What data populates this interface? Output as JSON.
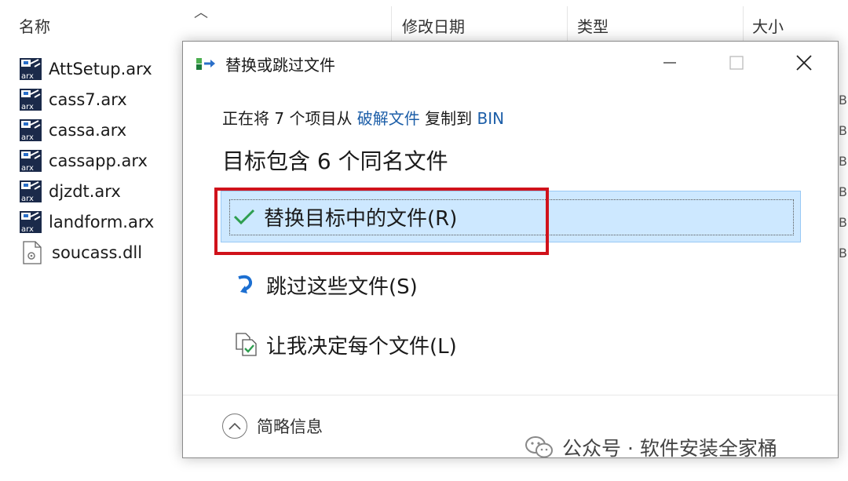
{
  "explorer": {
    "columns": {
      "name": "名称",
      "modified": "修改日期",
      "type": "类型",
      "size": "大小"
    },
    "files": [
      {
        "name": "AttSetup.arx",
        "icon": "arx-file-icon"
      },
      {
        "name": "cass7.arx",
        "icon": "arx-file-icon"
      },
      {
        "name": "cassa.arx",
        "icon": "arx-file-icon"
      },
      {
        "name": "cassapp.arx",
        "icon": "arx-file-icon"
      },
      {
        "name": "djzdt.arx",
        "icon": "arx-file-icon"
      },
      {
        "name": "landform.arx",
        "icon": "arx-file-icon"
      },
      {
        "name": "soucass.dll",
        "icon": "dll-file-icon"
      }
    ],
    "size_fragment": "B"
  },
  "dialog": {
    "title": "替换或跳过文件",
    "copy_line": {
      "prefix": "正在将 7 个项目从 ",
      "source": "破解文件",
      "middle": " 复制到 ",
      "target": "BIN"
    },
    "heading": "目标包含 6 个同名文件",
    "options": {
      "replace": "替换目标中的文件(R)",
      "skip": "跳过这些文件(S)",
      "decide": "让我决定每个文件(L)"
    },
    "footer": {
      "details": "简略信息"
    },
    "colors": {
      "highlight": "#cde8ff",
      "link": "#1c5ea8",
      "annotation": "#d0121b",
      "check": "#2e9e4f"
    }
  },
  "watermark": {
    "text": "公众号 · 软件安装全家桶"
  }
}
